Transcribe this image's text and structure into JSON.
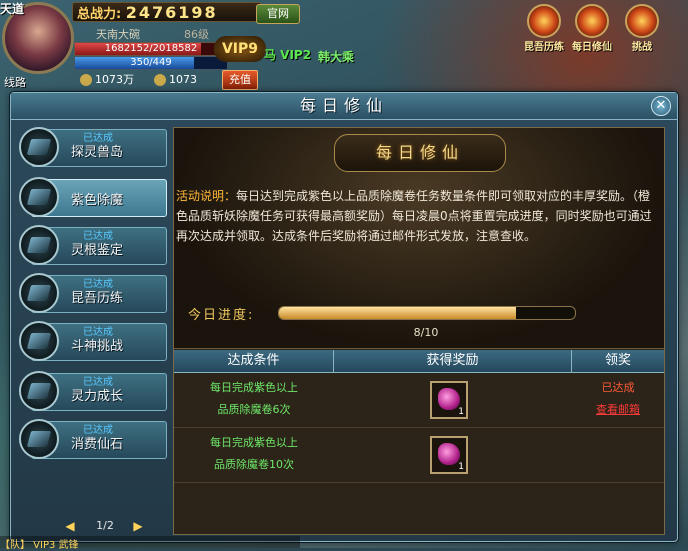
{
  "hud": {
    "server": "天道",
    "power_label": "总战力:",
    "power_value": "2476198",
    "official_button": "官网",
    "player_name": "天南大碗",
    "player_level": "86级",
    "hp_text": "1682152/2018582",
    "mp_text": "350/449",
    "vip_label": "VIP9",
    "gold": "1073万",
    "ingots": "1073",
    "recharge_button": "充值",
    "bottom_tag": "线路",
    "npc_vip": "马 VIP2",
    "npc_name": "韩大乘",
    "top_icons": [
      "昆吾历练",
      "每日修仙",
      "挑战"
    ]
  },
  "dialog": {
    "title": "每日修仙",
    "sidebar": [
      {
        "done": "已达成",
        "label": "探灵兽岛",
        "active": false
      },
      {
        "done": "",
        "label": "紫色除魔",
        "active": true
      },
      {
        "done": "已达成",
        "label": "灵根鉴定",
        "active": false
      },
      {
        "done": "已达成",
        "label": "昆吾历练",
        "active": false
      },
      {
        "done": "已达成",
        "label": "斗神挑战",
        "active": false
      },
      {
        "done": "已达成",
        "label": "灵力成长",
        "active": false
      },
      {
        "done": "已达成",
        "label": "消费仙石",
        "active": false
      }
    ],
    "pager": {
      "text": "1/2"
    },
    "panel": {
      "banner_title": "每日修仙",
      "desc_label": "活动说明：",
      "desc_text": "每日达到完成紫色以上品质除魔卷任务数量条件即可领取对应的丰厚奖励。（橙色品质斩妖除魔任务可获得最高额奖励）每日凌晨0点将重置完成进度，同时奖励也可通过再次达成并领取。达成条件后奖励将通过邮件形式发放，注意查收。",
      "progress_label": "今日进度:",
      "progress_value": 0.8,
      "progress_text": "8/10",
      "columns": [
        "达成条件",
        "获得奖励",
        "领奖"
      ],
      "rows": [
        {
          "cond1": "每日完成紫色以上",
          "cond2": "品质除魔卷6次",
          "count": "1",
          "status1": "已达成",
          "status2": "查看邮箱"
        },
        {
          "cond1": "每日完成紫色以上",
          "cond2": "品质除魔卷10次",
          "count": "1",
          "status1": "",
          "status2": ""
        }
      ]
    }
  },
  "chat": "【队】 VIP3 武锋",
  "colors": {
    "accent": "#8ab4c4",
    "gold": "#f4d98a",
    "green": "#6ee86a",
    "red": "#ff5a3a"
  }
}
